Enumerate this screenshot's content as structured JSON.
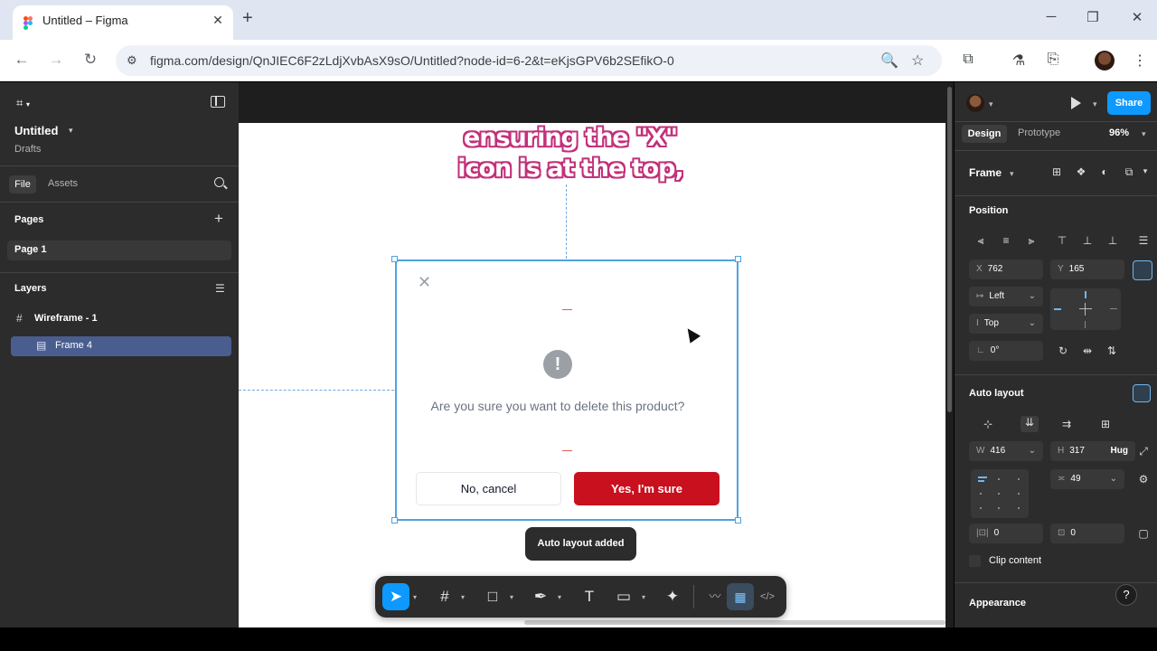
{
  "browser": {
    "tab_title": "Untitled – Figma",
    "tab_close": "✕",
    "new_tab": "+",
    "window_controls": {
      "minimize": "─",
      "maximize": "❐",
      "close": "✕"
    },
    "nav": {
      "back": "←",
      "forward": "→",
      "reload": "↻"
    },
    "url": "figma.com/design/QnJIEC6F2zLdjXvbAsX9sO/Untitled?node-id=6-2&t=eKjsGPV6b2SEfikO-0",
    "icons": {
      "site_info": "⚙",
      "zoom": "🔍",
      "bookmark": "☆",
      "extensions": "⧉",
      "labs": "⚗",
      "cast": "⎘",
      "menu": "⋮"
    }
  },
  "left_panel": {
    "logo": "⌗",
    "logo_chevron": "▾",
    "file_name": "Untitled",
    "file_chevron": "▾",
    "subtitle": "Drafts",
    "tabs": {
      "file": "File",
      "assets": "Assets"
    },
    "pages_heading": "Pages",
    "add_page": "+",
    "pages": [
      {
        "label": "Page 1"
      }
    ],
    "layers_heading": "Layers",
    "layers_icon": "☰",
    "layers": [
      {
        "icon": "#",
        "label": "Wireframe - 1"
      },
      {
        "icon": "▤",
        "label": "Frame 4"
      }
    ]
  },
  "canvas": {
    "caption_line1": "ensuring the \"X\"",
    "caption_line2": "icon is at the top,",
    "dialog": {
      "close_icon": "✕",
      "alert_icon": "!",
      "message": "Are you sure you want to delete this product?",
      "cancel_label": "No, cancel",
      "confirm_label": "Yes, I'm sure",
      "confirm_color": "#c8101e"
    },
    "toast": "Auto layout added"
  },
  "toolbar": {
    "tools": [
      {
        "name": "move",
        "glyph": "➤"
      },
      {
        "name": "frame",
        "glyph": "#"
      },
      {
        "name": "shape",
        "glyph": "□"
      },
      {
        "name": "pen",
        "glyph": "✒"
      },
      {
        "name": "text",
        "glyph": "T"
      },
      {
        "name": "comment",
        "glyph": "▭"
      },
      {
        "name": "actions",
        "glyph": "✦"
      },
      {
        "name": "draw",
        "glyph": "〰"
      },
      {
        "name": "design",
        "glyph": "▦"
      },
      {
        "name": "dev",
        "glyph": "</>"
      }
    ],
    "chevron": "▾"
  },
  "right_panel": {
    "avatar_chevron": "▾",
    "play_chevron": "▾",
    "share_label": "Share",
    "tabs": {
      "design": "Design",
      "prototype": "Prototype"
    },
    "zoom": "96%",
    "zoom_chevron": "▾",
    "frame_label": "Frame",
    "frame_chevron": "▾",
    "frame_icons": [
      "⊞",
      "❖",
      "◐",
      "⧉",
      "▾"
    ],
    "position_heading": "Position",
    "align_icons": [
      "⫷",
      "≡",
      "⫸",
      "⊤",
      "⊥",
      "⊥",
      "☰"
    ],
    "x_label": "X",
    "x_value": "762",
    "y_label": "Y",
    "y_value": "165",
    "h_constraint_icon": "↦",
    "h_constraint": "Left",
    "v_constraint_icon": "I",
    "v_constraint": "Top",
    "constraint_chevron": "⌄",
    "rotation_label": "∟",
    "rotation_value": "0°",
    "transform_icons": [
      "↻",
      "⇹",
      "⇅"
    ],
    "auto_layout_heading": "Auto layout",
    "al_icons": [
      "⊹",
      "⇊",
      "⇉",
      "⊞"
    ],
    "w_label": "W",
    "w_value": "416",
    "h_label": "H",
    "h_value": "317",
    "h_mode": "Hug",
    "gap_icon": "≍",
    "gap_value": "49",
    "padding_h_icon": "|⊡|",
    "padding_h": "0",
    "padding_v_icon": "⊡",
    "padding_v": "0",
    "clip_content": "Clip content",
    "appearance_heading": "Appearance",
    "help": "?",
    "accent": "#0d99ff"
  }
}
